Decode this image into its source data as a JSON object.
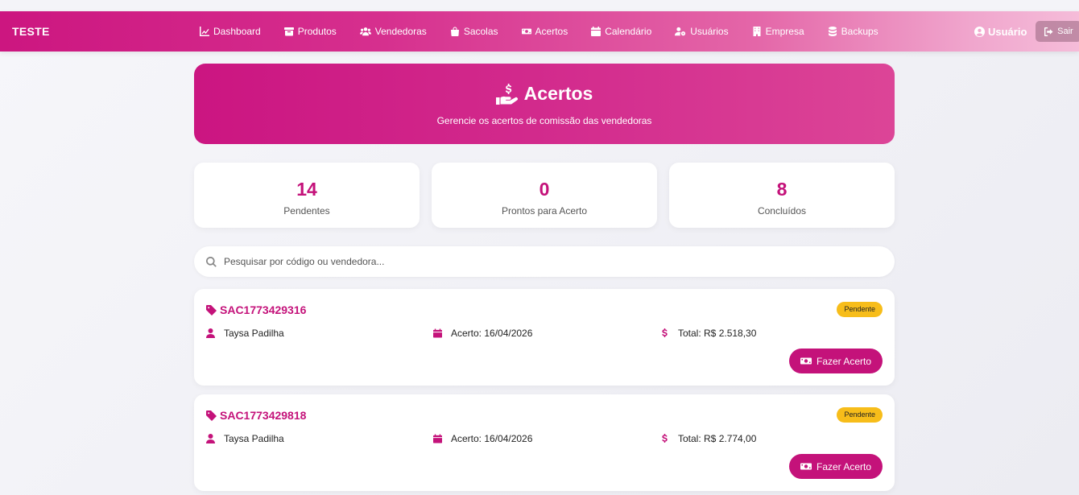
{
  "brand": "TESTE",
  "nav": [
    {
      "label": "Dashboard",
      "icon": "chart-icon"
    },
    {
      "label": "Produtos",
      "icon": "box-icon"
    },
    {
      "label": "Vendedoras",
      "icon": "users-icon"
    },
    {
      "label": "Sacolas",
      "icon": "bag-icon"
    },
    {
      "label": "Acertos",
      "icon": "money-icon"
    },
    {
      "label": "Calendário",
      "icon": "calendar-icon"
    },
    {
      "label": "Usuários",
      "icon": "user-gear-icon"
    },
    {
      "label": "Empresa",
      "icon": "building-icon"
    },
    {
      "label": "Backups",
      "icon": "database-icon"
    }
  ],
  "user": {
    "label": "Usuário",
    "logout": "Sair"
  },
  "hero": {
    "title": "Acertos",
    "subtitle": "Gerencie os acertos de comissão das vendedoras"
  },
  "stats": [
    {
      "value": "14",
      "label": "Pendentes"
    },
    {
      "value": "0",
      "label": "Prontos para Acerto"
    },
    {
      "value": "8",
      "label": "Concluídos"
    }
  ],
  "search": {
    "placeholder": "Pesquisar por código ou vendedora..."
  },
  "cards": [
    {
      "code": "SAC1773429316",
      "status": "Pendente",
      "seller": "Taysa Padilha",
      "date": "Acerto: 16/04/2026",
      "total": "Total: R$ 2.518,30",
      "action": "Fazer Acerto"
    },
    {
      "code": "SAC1773429818",
      "status": "Pendente",
      "seller": "Taysa Padilha",
      "date": "Acerto: 16/04/2026",
      "total": "Total: R$ 2.774,00",
      "action": "Fazer Acerto"
    }
  ],
  "colors": {
    "accent": "#c4127a",
    "badge": "#f7bd1a"
  }
}
